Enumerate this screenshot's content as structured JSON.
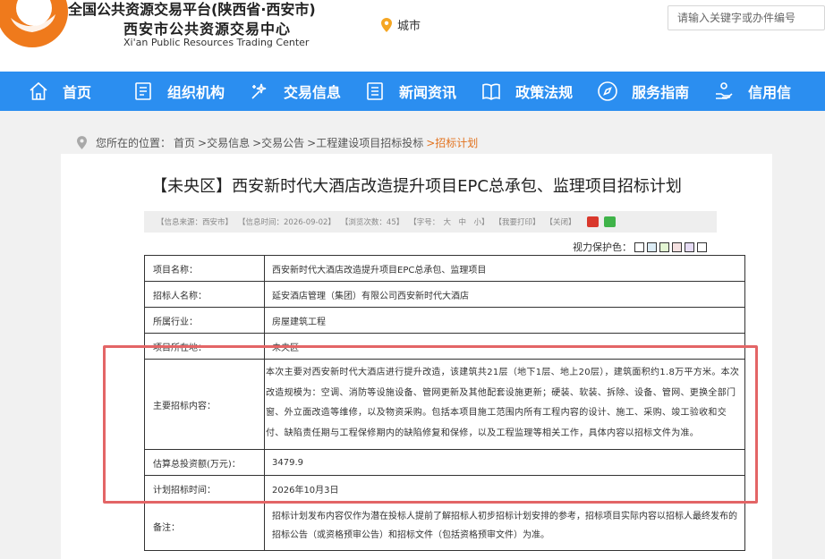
{
  "header": {
    "platform_line": "全国公共资源交易平台(陕西省·西安市)",
    "center_name": "西安市公共资源交易中心",
    "center_name_en": "Xi'an Public Resources Trading Center",
    "city_label": "城市",
    "search_placeholder": "请输入关键字或办件编号"
  },
  "nav": {
    "items": [
      {
        "label": "首页",
        "icon": "home-icon"
      },
      {
        "label": "组织机构",
        "icon": "document-icon"
      },
      {
        "label": "交易信息",
        "icon": "sparkle-icon"
      },
      {
        "label": "新闻资讯",
        "icon": "list-icon"
      },
      {
        "label": "政策法规",
        "icon": "book-icon"
      },
      {
        "label": "服务指南",
        "icon": "compass-icon"
      },
      {
        "label": "信用信",
        "icon": "hand-icon"
      }
    ]
  },
  "breadcrumb": {
    "prefix": "您所在的位置：",
    "items": [
      "首页",
      ">交易信息",
      ">交易公告",
      ">工程建设项目招标投标",
      ">招标计划"
    ]
  },
  "article": {
    "title": "【未央区】西安新时代大酒店改造提升项目EPC总承包、监理项目招标计划",
    "info": {
      "source": "【信息来源：西安市】",
      "time": "【信息时间：2026-09-02】",
      "views": "【浏览次数：45】",
      "font_size": "【字号：　大　中　小】",
      "print": "【我要打印】",
      "close": "【关闭】"
    },
    "vision_label": "视力保护色：",
    "vision_colors": [
      "#ffffff",
      "#dcecf5",
      "#e3f6d3",
      "#f5e1e1",
      "#e6dcf5",
      "#ffffff"
    ]
  },
  "table": {
    "project_name": {
      "label": "项目名称：",
      "value": "西安新时代大酒店改造提升项目EPC总承包、监理项目"
    },
    "tenderer": {
      "label": "招标人名称：",
      "value": "延安酒店管理（集团）有限公司西安新时代大酒店"
    },
    "industry": {
      "label": "所属行业：",
      "value": "房屋建筑工程"
    },
    "location": {
      "label": "项目所在地：",
      "value": "未央区"
    },
    "content": {
      "label": "主要招标内容：",
      "value": "本次主要对西安新时代大酒店进行提升改造，该建筑共21层（地下1层、地上20层），建筑面积约1.8万平方米。本次改造规模为：空调、消防等设施设备、管网更新及其他配套设施更新；硬装、软装、拆除、设备、管网、更换全部门窗、外立面改造等维修，以及物资采购。包括本项目施工范围内所有工程内容的设计、施工、采购、竣工验收和交付、缺陷责任期与工程保修期内的缺陷修复和保修，以及工程监理等相关工作，具体内容以招标文件为准。"
    },
    "investment": {
      "label": "估算总投资额(万元)：",
      "value": "3479.9"
    },
    "plan_time": {
      "label": "计划招标时间：",
      "value": "2026年10月3日"
    },
    "remark": {
      "label": "备注：",
      "value": "招标计划发布内容仅作为潜在投标人提前了解招标人初步招标计划安排的参考，招标项目实际内容以招标人最终发布的招标公告（或资格预审公告）和招标文件（包括资格预审文件）为准。"
    }
  },
  "colors": {
    "nav_bg": "#2b8ef0",
    "logo_orange": "#ef7a1c",
    "highlight_red": "#e36566",
    "breadcrumb_current": "#e2731f"
  }
}
